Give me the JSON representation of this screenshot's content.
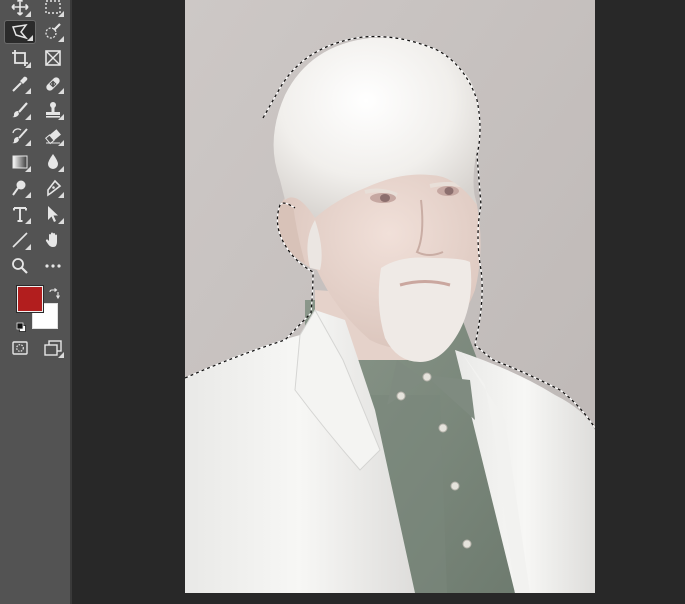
{
  "toolbar": {
    "tools": [
      {
        "id": "move-tool",
        "icon": "move-icon"
      },
      {
        "id": "marquee-tool",
        "icon": "rect-marquee-icon"
      },
      {
        "id": "polygonal-lasso-tool",
        "icon": "polygonal-lasso-icon",
        "active": true
      },
      {
        "id": "quick-selection-tool",
        "icon": "quick-selection-icon"
      },
      {
        "id": "crop-tool",
        "icon": "crop-icon"
      },
      {
        "id": "frame-tool",
        "icon": "frame-icon"
      },
      {
        "id": "eyedropper-tool",
        "icon": "eyedropper-icon"
      },
      {
        "id": "healing-brush-tool",
        "icon": "bandage-icon"
      },
      {
        "id": "brush-tool",
        "icon": "brush-icon"
      },
      {
        "id": "clone-stamp-tool",
        "icon": "stamp-icon"
      },
      {
        "id": "history-brush-tool",
        "icon": "history-brush-icon"
      },
      {
        "id": "eraser-tool",
        "icon": "eraser-icon"
      },
      {
        "id": "gradient-tool",
        "icon": "gradient-icon"
      },
      {
        "id": "blur-tool",
        "icon": "drop-icon"
      },
      {
        "id": "dodge-tool",
        "icon": "dodge-icon"
      },
      {
        "id": "pen-tool",
        "icon": "pen-icon"
      },
      {
        "id": "type-tool",
        "icon": "type-icon",
        "label": "T"
      },
      {
        "id": "path-selection-tool",
        "icon": "arrow-icon"
      },
      {
        "id": "line-tool",
        "icon": "line-icon"
      },
      {
        "id": "hand-tool",
        "icon": "hand-icon"
      },
      {
        "id": "zoom-tool",
        "icon": "zoom-icon"
      },
      {
        "id": "more-tools",
        "icon": "more-icon"
      }
    ],
    "foreground_color": "#b21e1e",
    "background_color": "#ffffff"
  },
  "document": {
    "background_color": "#c9c4c2",
    "selection": "marching-ants"
  }
}
